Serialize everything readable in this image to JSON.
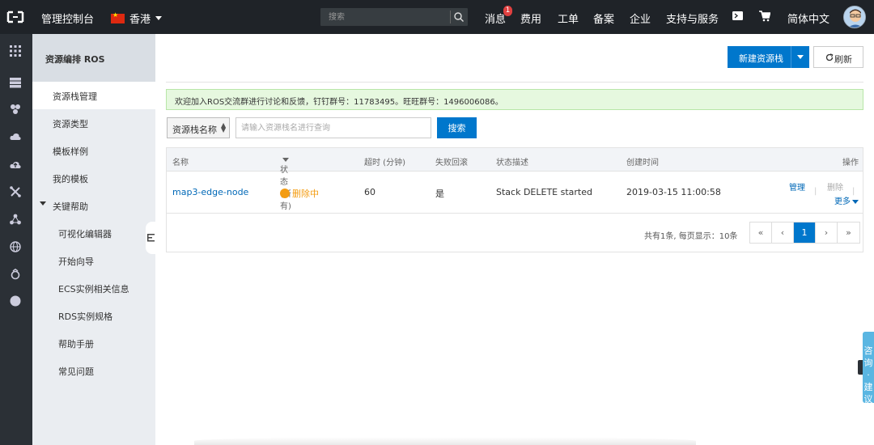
{
  "topbar": {
    "console_label": "管理控制台",
    "region_label": "香港",
    "search_placeholder": "搜索",
    "nav": {
      "messages": "消息",
      "messages_badge": "1",
      "billing": "费用",
      "tickets": "工单",
      "icp": "备案",
      "enterprise": "企业",
      "support": "支持与服务",
      "language": "简体中文"
    }
  },
  "sidebar": {
    "title": "资源编排 ROS",
    "items": [
      {
        "label": "资源栈管理"
      },
      {
        "label": "资源类型"
      },
      {
        "label": "模板样例"
      },
      {
        "label": "我的模板"
      },
      {
        "label": "关键帮助"
      },
      {
        "label": "可视化编辑器"
      },
      {
        "label": "开始向导"
      },
      {
        "label": "ECS实例相关信息"
      },
      {
        "label": "RDS实例规格"
      },
      {
        "label": "帮助手册"
      },
      {
        "label": "常见问题"
      }
    ]
  },
  "main": {
    "new_stack_label": "新建资源栈",
    "refresh_label": "刷新",
    "notice": "欢迎加入ROS交流群进行讨论和反馈，钉钉群号：11783495。旺旺群号：1496006086。",
    "filter_select": "资源栈名称",
    "query_placeholder": "请输入资源栈名进行查询",
    "search_button": "搜索",
    "table": {
      "headers": [
        "名称",
        "状态 (所有)",
        "超时 (分钟)",
        "失败回滚",
        "状态描述",
        "创建时间",
        "操作"
      ],
      "rows": [
        {
          "name": "map3-edge-node",
          "status": "删除中",
          "timeout": "60",
          "rollback": "是",
          "status_desc": "Stack DELETE started",
          "created": "2019-03-15 11:00:58",
          "op_manage": "管理",
          "op_delete": "删除",
          "op_more": "更多"
        }
      ]
    },
    "pager": {
      "summary": "共有1条, 每页显示：10条",
      "first": "«",
      "prev": "‹",
      "current": "1",
      "next": "›",
      "last": "»"
    }
  },
  "consult": {
    "label": "咨询·建议"
  },
  "colors": {
    "primary": "#0077cc",
    "topbar": "#1f2328",
    "status_deleting": "#f39c12",
    "notice_bg": "#e6f8df"
  }
}
